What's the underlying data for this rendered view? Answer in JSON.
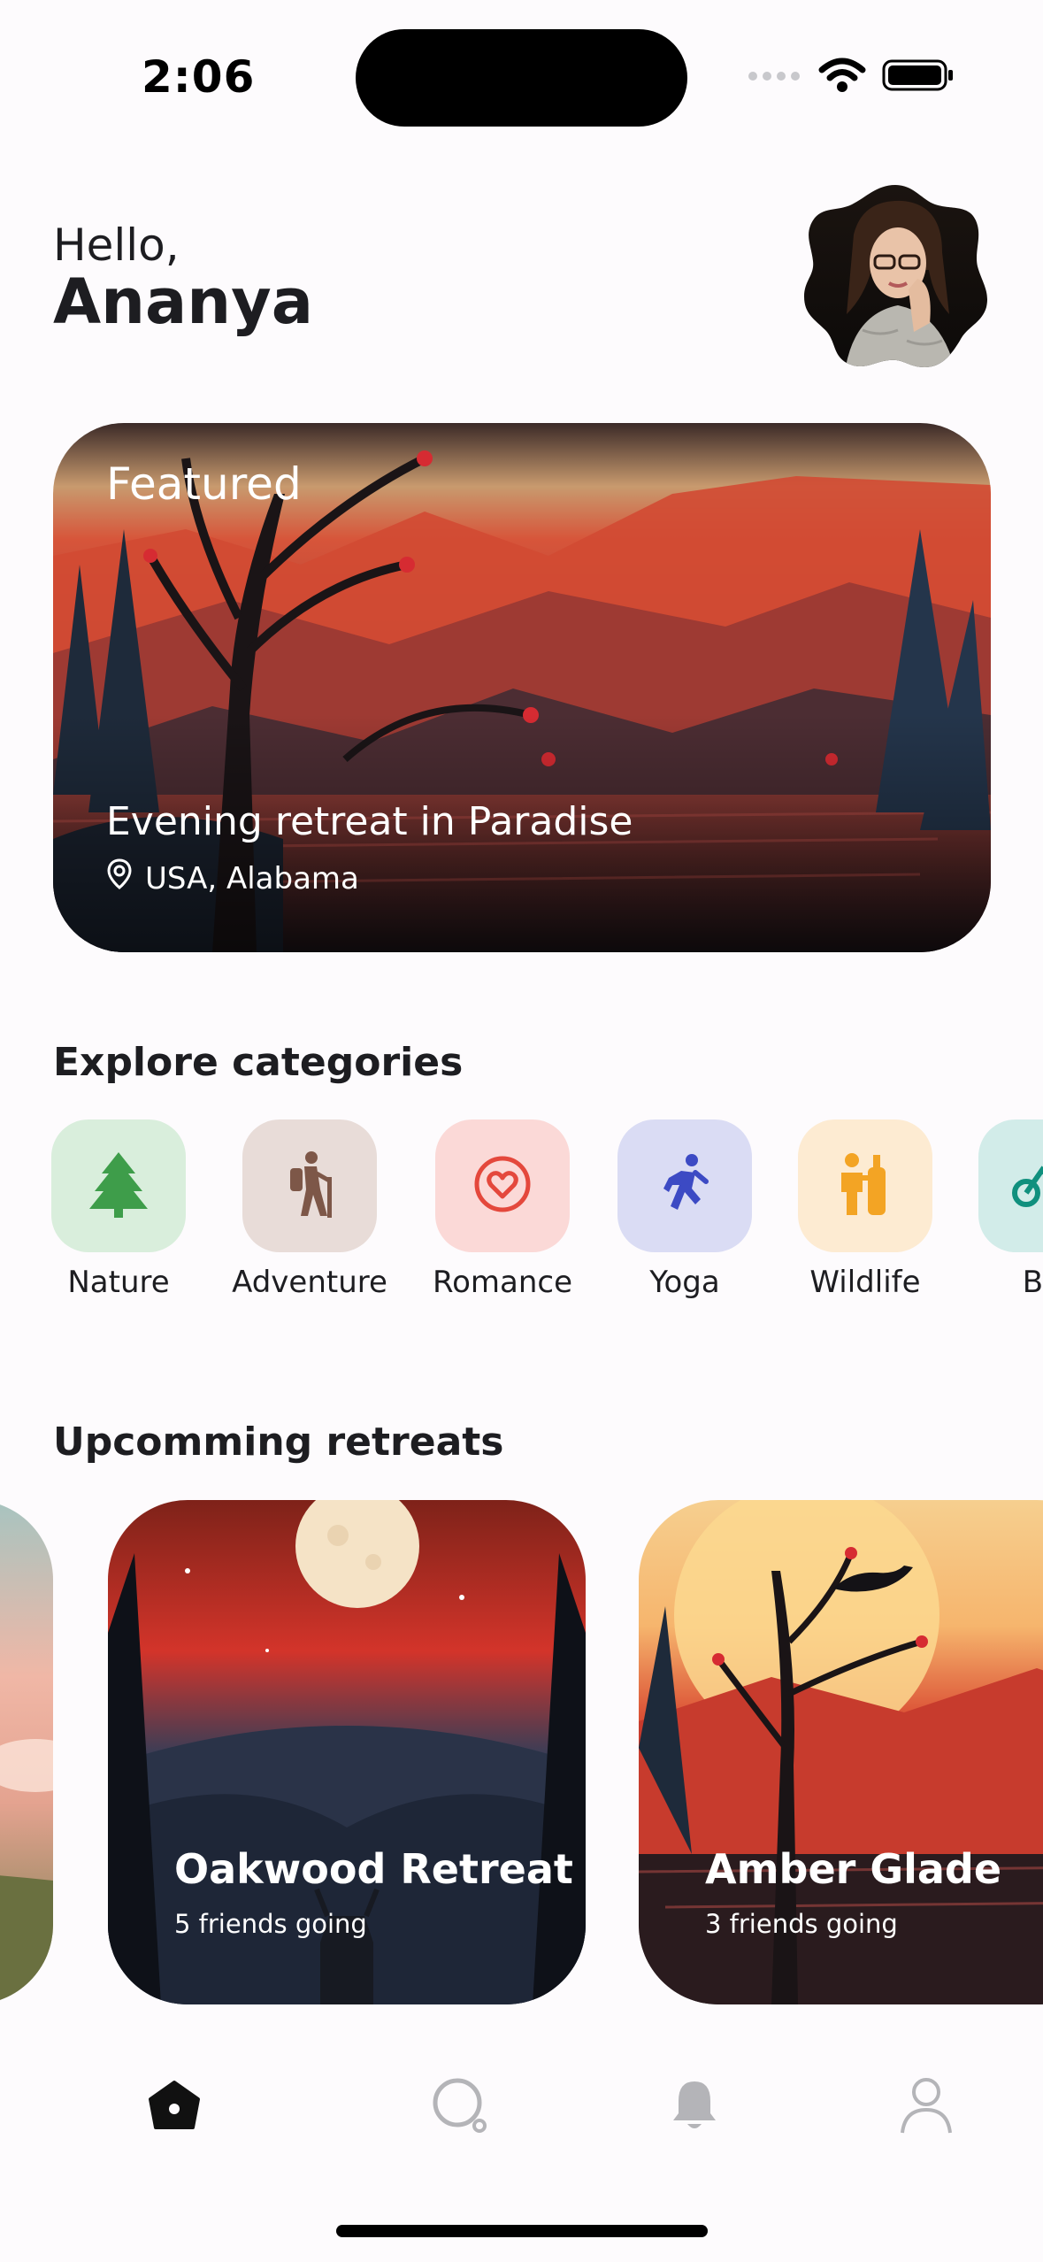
{
  "status_bar": {
    "time": "2:06",
    "icons": [
      "signal-icon",
      "wifi-icon",
      "battery-icon"
    ]
  },
  "header": {
    "greeting": "Hello,",
    "user_name": "Ananya",
    "avatar": "profile-avatar"
  },
  "featured": {
    "label": "Featured",
    "title": "Evening retreat in Paradise",
    "location": "USA, Alabama",
    "location_icon": "location-pin-icon"
  },
  "categories": {
    "title": "Explore categories",
    "items": [
      {
        "label": "Nature",
        "icon": "tree-icon",
        "bg": "#d9eedc",
        "fg": "#3e9d4a"
      },
      {
        "label": "Adventure",
        "icon": "hiker-icon",
        "bg": "#e8dcd8",
        "fg": "#7d5748"
      },
      {
        "label": "Romance",
        "icon": "heart-icon",
        "bg": "#fbd9d7",
        "fg": "#e4483c"
      },
      {
        "label": "Yoga",
        "icon": "runner-icon",
        "bg": "#dadcf4",
        "fg": "#3c4ac4"
      },
      {
        "label": "Wildlife",
        "icon": "wildlife-icon",
        "bg": "#fdebd2",
        "fg": "#f3a424"
      },
      {
        "label": "Bik",
        "icon": "bike-icon",
        "bg": "#d2ece9",
        "fg": "#10907e"
      }
    ]
  },
  "retreats": {
    "title": "Upcomming retreats",
    "items": [
      {
        "name": "Oakwood Retreat",
        "subtitle": "5 friends going"
      },
      {
        "name": "Amber Glade",
        "subtitle": "3 friends going"
      }
    ]
  },
  "bottom_nav": {
    "items": [
      {
        "name": "home",
        "icon": "home-icon",
        "active": true
      },
      {
        "name": "search",
        "icon": "search-icon",
        "active": false
      },
      {
        "name": "notifications",
        "icon": "bell-icon",
        "active": false
      },
      {
        "name": "profile",
        "icon": "user-icon",
        "active": false
      }
    ]
  },
  "colors": {
    "background": "#fdfbfd",
    "text": "#1d1d21",
    "nav_inactive": "#b4b4b8"
  }
}
